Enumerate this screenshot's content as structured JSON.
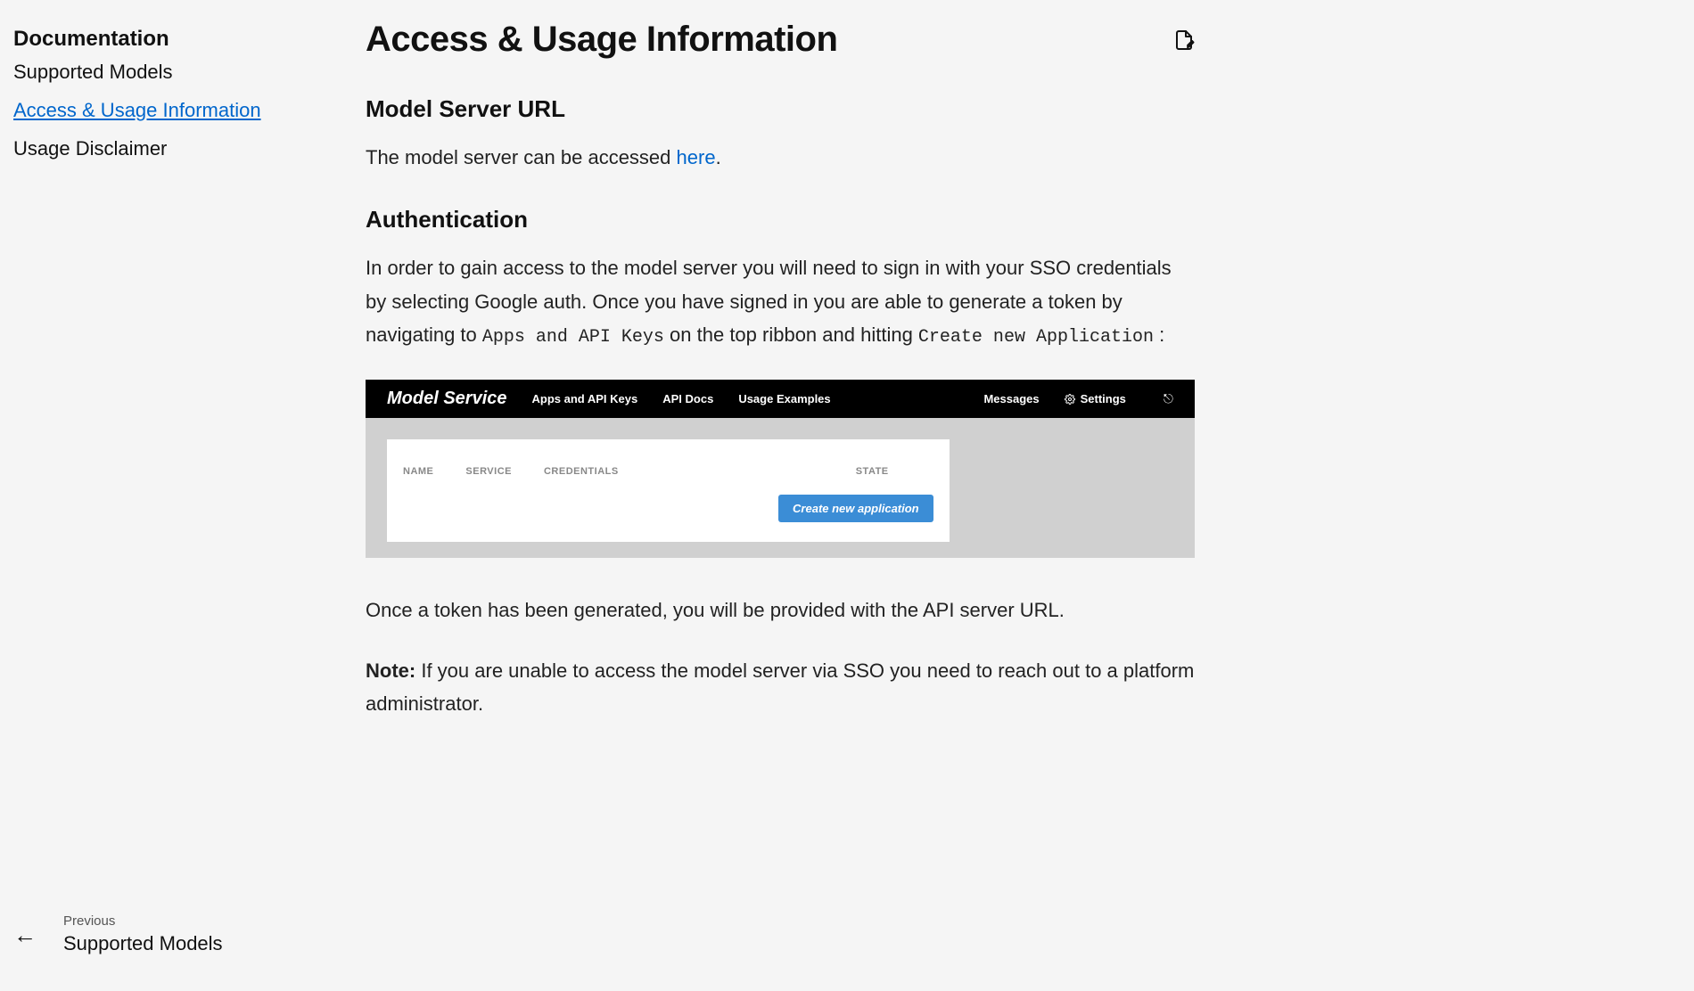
{
  "sidebar": {
    "heading": "Documentation",
    "items": [
      {
        "label": "Supported Models",
        "active": false
      },
      {
        "label": "Access & Usage Information",
        "active": true
      },
      {
        "label": "Usage Disclaimer",
        "active": false
      }
    ],
    "prev": {
      "label": "Previous",
      "title": "Supported Models"
    }
  },
  "page": {
    "title": "Access & Usage Information",
    "sections": {
      "model_server_url": {
        "heading": "Model Server URL",
        "text_pre": "The model server can be accessed ",
        "link_text": "here",
        "text_post": "."
      },
      "authentication": {
        "heading": "Authentication",
        "para1_pre": "In order to gain access to the model server you will need to sign in with your SSO credentials by selecting Google auth. Once you have signed in you are able to generate a token by navigating to ",
        "code1": "Apps and API Keys",
        "para1_mid": " on the top ribbon and hitting ",
        "code2": "Create new Application",
        "para1_post": " :",
        "para2": "Once a token has been generated, you will be provided with the API server URL.",
        "note_label": "Note:",
        "note_text": " If you are unable to access the model server via SSO you need to reach out to a platform administrator."
      }
    }
  },
  "embedded_screenshot": {
    "logo": "Model Service",
    "nav": [
      "Apps and API Keys",
      "API Docs",
      "Usage Examples"
    ],
    "right": [
      "Messages",
      "Settings"
    ],
    "table_headers": [
      "NAME",
      "SERVICE",
      "CREDENTIALS",
      "STATE"
    ],
    "button": "Create new application"
  }
}
